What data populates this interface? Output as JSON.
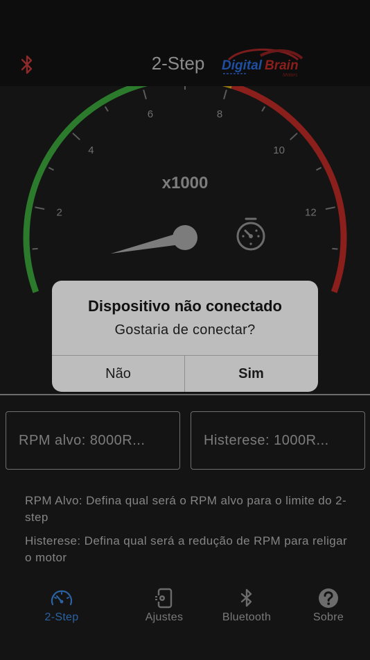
{
  "header": {
    "title": "2-Step",
    "logo_text_a": "Digital",
    "logo_text_b": "Brain",
    "logo_sub": "Motors"
  },
  "gauge": {
    "multiplier_label": "x1000",
    "tick_labels": [
      "2",
      "4",
      "6",
      "8",
      "10",
      "12"
    ],
    "rpm_value_thousands": 0.5,
    "colors": {
      "green_zone": "#2c7a2c",
      "yellow_zone": "#9a7a12",
      "red_zone": "#8a1f1c",
      "needle": "#7c7c7c"
    }
  },
  "fields": {
    "rpm_target": {
      "value": "RPM alvo: 8000R..."
    },
    "hysteresis": {
      "value": "Histerese: 1000R..."
    }
  },
  "help": {
    "rpm_text": "RPM Alvo: Defina qual será o RPM alvo para o limite do 2-step",
    "hysteresis_text": "Histerese: Defina qual será a redução de RPM para religar o motor"
  },
  "tabs": [
    {
      "label": "2-Step",
      "icon": "speedometer-icon",
      "active": true
    },
    {
      "label": "Ajustes",
      "icon": "settings-phone-icon",
      "active": false
    },
    {
      "label": "Bluetooth",
      "icon": "bluetooth-icon",
      "active": false
    },
    {
      "label": "Sobre",
      "icon": "help-circle-icon",
      "active": false
    }
  ],
  "dialog": {
    "title": "Dispositivo não conectado",
    "message": "Gostaria de conectar?",
    "no_label": "Não",
    "yes_label": "Sim"
  },
  "colors": {
    "accent": "#2b63a3",
    "bluetooth_off": "#8e2a2a",
    "background": "#141414"
  }
}
